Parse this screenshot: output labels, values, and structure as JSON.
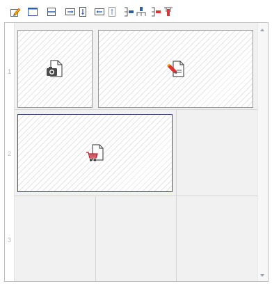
{
  "toolbar": {
    "buttons": [
      {
        "icon": "edit-pencil-icon"
      },
      {
        "icon": "single-frame-icon"
      },
      {
        "icon": "horizontal-split-icon"
      },
      {
        "icon": "expand-right-icon"
      },
      {
        "icon": "expand-down-icon"
      },
      {
        "icon": "shrink-left-icon"
      },
      {
        "icon": "shrink-up-icon"
      },
      {
        "icon": "insert-row-icon"
      },
      {
        "icon": "insert-column-icon"
      },
      {
        "icon": "delete-row-icon"
      },
      {
        "icon": "delete-column-icon"
      }
    ]
  },
  "grid": {
    "row_numbers": [
      "1",
      "2",
      "3"
    ]
  },
  "widgets": [
    {
      "icon": "camera-document-icon"
    },
    {
      "icon": "edit-document-icon"
    },
    {
      "icon": "shopping-cart-document-icon",
      "selected": true
    }
  ],
  "colors": {
    "selected_border": "#3d4a86",
    "pencil_accent": "#f2a400",
    "edit_accent": "#e03030",
    "cart_accent": "#c0182a"
  }
}
